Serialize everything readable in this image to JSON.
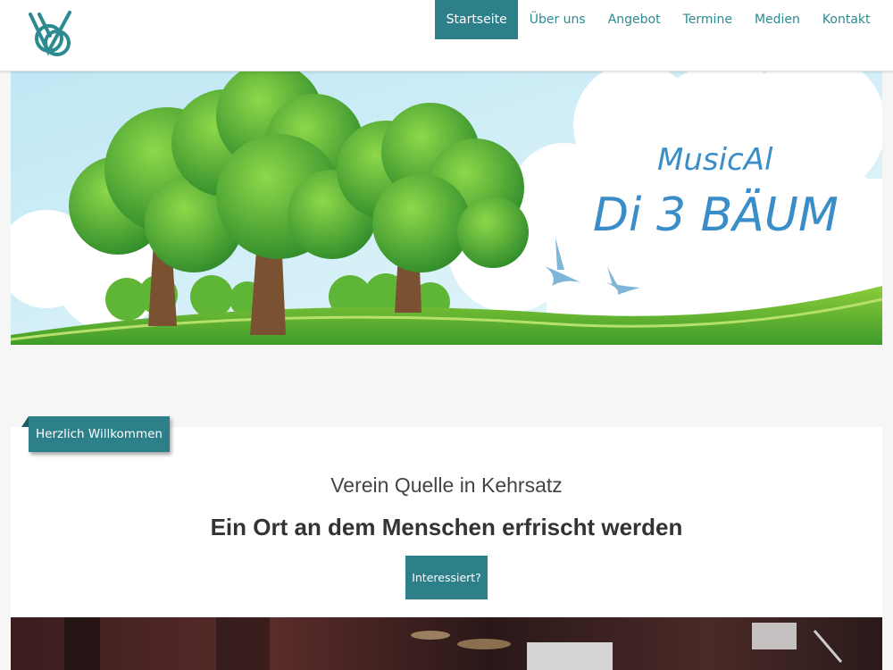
{
  "header": {
    "nav": [
      {
        "label": "Startseite",
        "active": true
      },
      {
        "label": "Über uns"
      },
      {
        "label": "Angebot"
      },
      {
        "label": "Termine"
      },
      {
        "label": "Medien"
      },
      {
        "label": "Kontakt"
      }
    ]
  },
  "hero": {
    "banner_line1": "MusicAl",
    "banner_line2": "Di 3 BÄUM"
  },
  "welcome": {
    "ribbon_label": "Herzlich Willkommen",
    "subtitle": "Verein Quelle in Kehrsatz",
    "headline": "Ein Ort an dem Menschen erfrischt werden",
    "cta_label": "Interessiert?"
  },
  "colors": {
    "accent": "#2d7f8a",
    "nav_text": "#2d8a90",
    "banner_text": "#3a8ec8"
  }
}
